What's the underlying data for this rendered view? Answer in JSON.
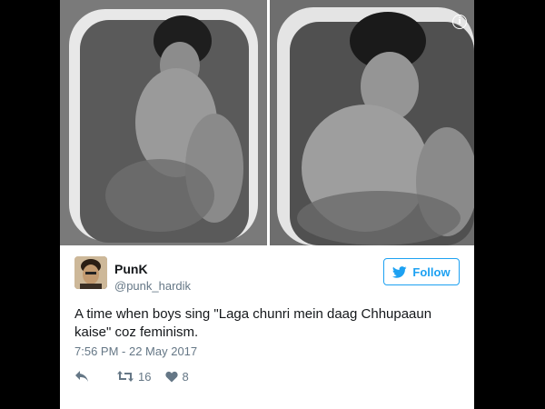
{
  "tweet": {
    "display_name": "PunK",
    "handle": "@punk_hardik",
    "follow_label": "Follow",
    "text": "A time when boys sing \"Laga chunri mein daag Chhupaaun kaise\" coz feminism.",
    "timestamp": "7:56 PM - 22 May 2017",
    "retweet_count": "16",
    "like_count": "8"
  },
  "icons": {
    "info": "info-icon",
    "twitter_bird": "twitter-bird-icon",
    "reply": "reply-icon",
    "retweet": "retweet-icon",
    "like": "heart-icon"
  },
  "colors": {
    "accent": "#1da1f2",
    "secondary_text": "#657786",
    "primary_text": "#14171a"
  }
}
